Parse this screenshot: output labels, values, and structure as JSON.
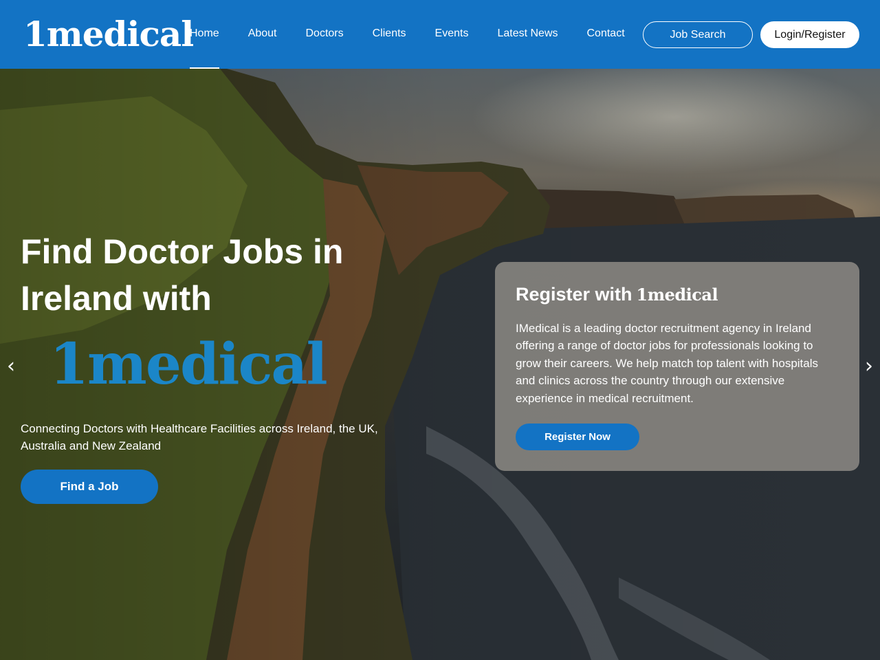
{
  "brand": {
    "logo_text": "1medical"
  },
  "nav": {
    "items": [
      {
        "label": "Home"
      },
      {
        "label": "About"
      },
      {
        "label": "Doctors"
      },
      {
        "label": "Clients"
      },
      {
        "label": "Events"
      },
      {
        "label": "Latest News"
      },
      {
        "label": "Contact"
      }
    ],
    "active": "Home"
  },
  "header_actions": {
    "job_search": "Job Search",
    "login_register": "Login/Register"
  },
  "hero": {
    "title": "Find Doctor Jobs in Ireland with",
    "logo_text": "1medical",
    "subtitle": "Connecting Doctors with Healthcare Facilities across Ireland, the UK, Australia and New Zealand",
    "cta": "Find a Job",
    "prev_arrow": "‹",
    "next_arrow": "›"
  },
  "register_card": {
    "title": "Register with",
    "title_logo": "1medical",
    "text": "IMedical is a leading doctor recruitment agency in Ireland offering a range of doctor jobs for professionals looking to grow their careers. We help match top talent with hospitals and clinics across the country through our extensive experience in medical recruitment.",
    "cta": "Register Now"
  },
  "colors": {
    "brand_blue": "#1373c4",
    "logo_blue": "#1b86c8",
    "white": "#ffffff"
  },
  "icons": {
    "prev": "chevron-left-icon",
    "next": "chevron-right-icon"
  }
}
